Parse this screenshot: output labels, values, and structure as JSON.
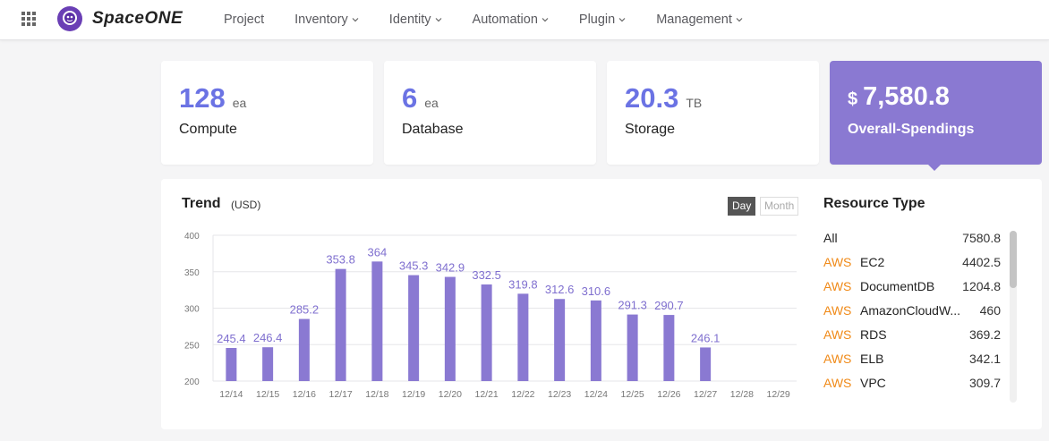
{
  "brand": {
    "name": "SpaceONE",
    "accent": "#6b73e4",
    "primary": "#8a79d2",
    "aws_color": "#f08a18"
  },
  "nav": [
    {
      "label": "Project",
      "dropdown": false
    },
    {
      "label": "Inventory",
      "dropdown": true
    },
    {
      "label": "Identity",
      "dropdown": true
    },
    {
      "label": "Automation",
      "dropdown": true
    },
    {
      "label": "Plugin",
      "dropdown": true
    },
    {
      "label": "Management",
      "dropdown": true
    }
  ],
  "cards": [
    {
      "value": "128",
      "unit": "ea",
      "label": "Compute"
    },
    {
      "value": "6",
      "unit": "ea",
      "label": "Database"
    },
    {
      "value": "20.3",
      "unit": "TB",
      "label": "Storage"
    },
    {
      "currency": "$",
      "value": "7,580.8",
      "label": "Overall-Spendings"
    }
  ],
  "trend": {
    "title": "Trend",
    "unit": "(USD)",
    "toggle_day": "Day",
    "toggle_month": "Month",
    "selected": "Day"
  },
  "chart_data": {
    "type": "bar",
    "categories": [
      "12/14",
      "12/15",
      "12/16",
      "12/17",
      "12/18",
      "12/19",
      "12/20",
      "12/21",
      "12/22",
      "12/23",
      "12/24",
      "12/25",
      "12/26",
      "12/27",
      "12/28",
      "12/29"
    ],
    "values": [
      245.4,
      246.4,
      285.2,
      353.8,
      364,
      345.3,
      342.9,
      332.5,
      319.8,
      312.6,
      310.6,
      291.3,
      290.7,
      246.1,
      null,
      null
    ],
    "value_labels": [
      "245.4",
      "246.4",
      "285.2",
      "353.8",
      "364",
      "345.3",
      "342.9",
      "332.5",
      "319.8",
      "312.6",
      "310.6",
      "291.3",
      "290.7",
      "246.1",
      "",
      ""
    ],
    "yticks": [
      200,
      250,
      300,
      350,
      400
    ],
    "ylim": [
      200,
      400
    ],
    "grid": true,
    "bar_color": "#8a79d2",
    "label_color": "#7f6fcf"
  },
  "resource_type": {
    "title": "Resource Type",
    "all_label": "All",
    "all_value": "7580.8",
    "items": [
      {
        "provider": "AWS",
        "name": "EC2",
        "value": "4402.5"
      },
      {
        "provider": "AWS",
        "name": "DocumentDB",
        "value": "1204.8"
      },
      {
        "provider": "AWS",
        "name": "AmazonCloudW...",
        "value": "460"
      },
      {
        "provider": "AWS",
        "name": "RDS",
        "value": "369.2"
      },
      {
        "provider": "AWS",
        "name": "ELB",
        "value": "342.1"
      },
      {
        "provider": "AWS",
        "name": "VPC",
        "value": "309.7"
      }
    ]
  }
}
